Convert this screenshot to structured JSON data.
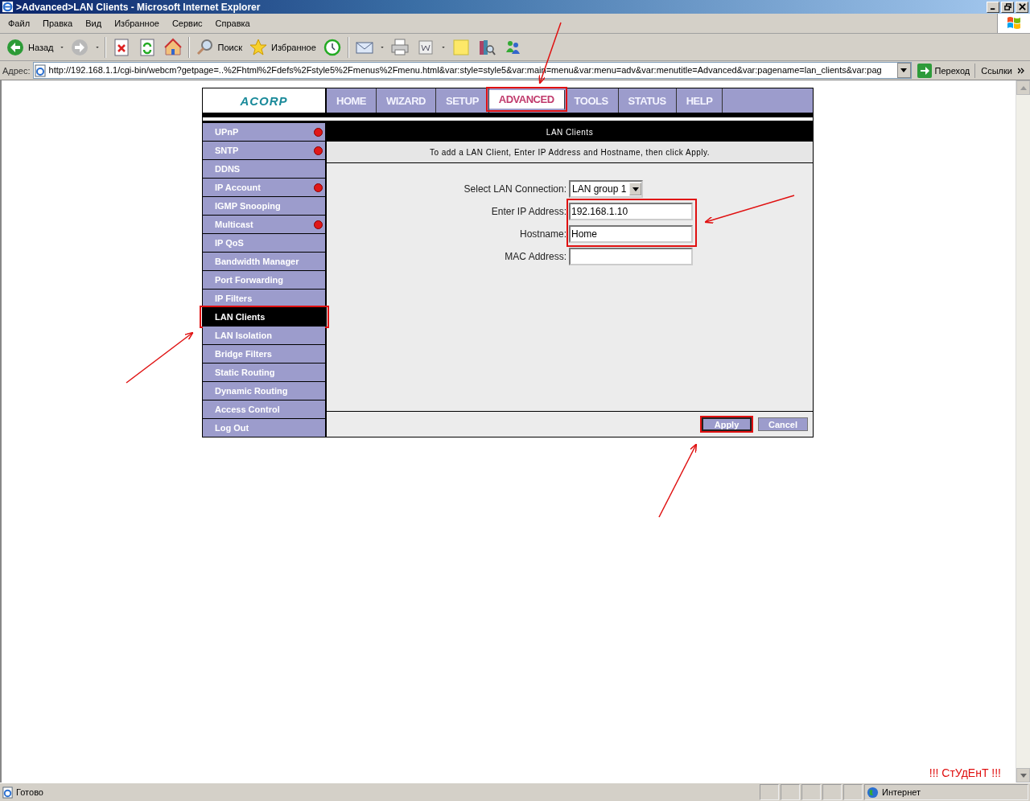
{
  "window": {
    "title": ">Advanced>LAN Clients - Microsoft Internet Explorer"
  },
  "menu_bar": [
    "Файл",
    "Правка",
    "Вид",
    "Избранное",
    "Сервис",
    "Справка"
  ],
  "toolbar": [
    {
      "kind": "back",
      "label": "Назад",
      "dropdown": true
    },
    {
      "kind": "forward",
      "dropdown": true
    },
    {
      "kind": "stop",
      "dropdown": false
    },
    {
      "kind": "refresh",
      "dropdown": false
    },
    {
      "kind": "home",
      "dropdown": false
    },
    {
      "kind": "search",
      "label": "Поиск",
      "dropdown": false
    },
    {
      "kind": "favorites",
      "label": "Избранное",
      "dropdown": false
    },
    {
      "kind": "history",
      "dropdown": false
    },
    {
      "kind": "mail",
      "dropdown": true
    },
    {
      "kind": "print",
      "dropdown": false
    },
    {
      "kind": "edit",
      "dropdown": true
    },
    {
      "kind": "note",
      "dropdown": false
    },
    {
      "kind": "research",
      "dropdown": false
    },
    {
      "kind": "messenger",
      "dropdown": false
    }
  ],
  "address_bar": {
    "label": "Адрес:",
    "url": "http://192.168.1.1/cgi-bin/webcm?getpage=..%2Fhtml%2Fdefs%2Fstyle5%2Fmenus%2Fmenu.html&var:style=style5&var:main=menu&var:menu=adv&var:menutitle=Advanced&var:pagename=lan_clients&var:pag",
    "go_label": "Переход",
    "links_label": "Ссылки"
  },
  "router": {
    "logo": "ACORP",
    "nav_tabs": [
      {
        "label": "HOME",
        "selected": false,
        "annotated": false
      },
      {
        "label": "WIZARD",
        "selected": false,
        "annotated": false
      },
      {
        "label": "SETUP",
        "selected": false,
        "annotated": false
      },
      {
        "label": "ADVANCED",
        "selected": true,
        "annotated": true
      },
      {
        "label": "TOOLS",
        "selected": false,
        "annotated": false
      },
      {
        "label": "STATUS",
        "selected": false,
        "annotated": false
      },
      {
        "label": "HELP",
        "selected": false,
        "annotated": false
      }
    ],
    "sidebar": [
      {
        "label": "UPnP",
        "selected": false,
        "indicator": true,
        "annotated": false
      },
      {
        "label": "SNTP",
        "selected": false,
        "indicator": true,
        "annotated": false
      },
      {
        "label": "DDNS",
        "selected": false,
        "indicator": false,
        "annotated": false
      },
      {
        "label": "IP Account",
        "selected": false,
        "indicator": true,
        "annotated": false
      },
      {
        "label": "IGMP Snooping",
        "selected": false,
        "indicator": false,
        "annotated": false
      },
      {
        "label": "Multicast",
        "selected": false,
        "indicator": true,
        "annotated": false
      },
      {
        "label": "IP QoS",
        "selected": false,
        "indicator": false,
        "annotated": false
      },
      {
        "label": "Bandwidth Manager",
        "selected": false,
        "indicator": false,
        "annotated": false
      },
      {
        "label": "Port Forwarding",
        "selected": false,
        "indicator": false,
        "annotated": false
      },
      {
        "label": "IP Filters",
        "selected": false,
        "indicator": false,
        "annotated": false
      },
      {
        "label": "LAN Clients",
        "selected": true,
        "indicator": false,
        "annotated": true
      },
      {
        "label": "LAN Isolation",
        "selected": false,
        "indicator": false,
        "annotated": false
      },
      {
        "label": "Bridge Filters",
        "selected": false,
        "indicator": false,
        "annotated": false
      },
      {
        "label": "Static Routing",
        "selected": false,
        "indicator": false,
        "annotated": false
      },
      {
        "label": "Dynamic Routing",
        "selected": false,
        "indicator": false,
        "annotated": false
      },
      {
        "label": "Access Control",
        "selected": false,
        "indicator": false,
        "annotated": false
      },
      {
        "label": "Log Out",
        "selected": false,
        "indicator": false,
        "annotated": false
      }
    ],
    "panel": {
      "title": "LAN Clients",
      "description": "To add a LAN Client, Enter IP Address and Hostname, then click Apply.",
      "fields": [
        {
          "kind": "select",
          "label": "Select LAN Connection:",
          "value": "LAN group 1",
          "annotated": false
        },
        {
          "kind": "text",
          "label": "Enter IP Address:",
          "value": "192.168.1.10",
          "annotated": true
        },
        {
          "kind": "text",
          "label": "Hostname:",
          "value": "Home",
          "annotated": true
        },
        {
          "kind": "text",
          "label": "MAC Address:",
          "annotated": false
        }
      ],
      "buttons": [
        {
          "label": "Apply",
          "default": true,
          "annotated": true
        },
        {
          "label": "Cancel",
          "default": false,
          "annotated": false
        }
      ]
    }
  },
  "annotation_text": "!!! СтУдЕнТ !!!",
  "status_bar": {
    "text": "Готово",
    "zone": "Интернет"
  }
}
